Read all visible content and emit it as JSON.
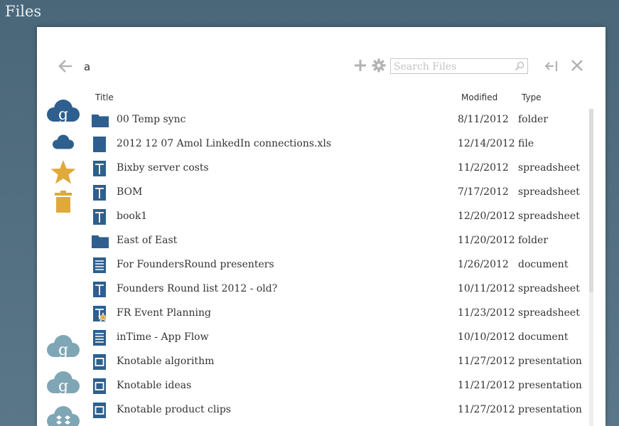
{
  "app": {
    "title": "Files"
  },
  "toolbar": {
    "path": "a",
    "search_placeholder": "Search Files",
    "icons": [
      "arrow-left-icon",
      "plus-icon",
      "gear-icon",
      "search-icon",
      "collapse-panel-icon",
      "close-icon"
    ]
  },
  "sources": [
    {
      "name": "google-drive",
      "icon": "google-cloud-icon"
    },
    {
      "name": "cloud",
      "icon": "cloud-icon"
    },
    {
      "name": "starred",
      "icon": "star-icon"
    },
    {
      "name": "trash",
      "icon": "trash-icon"
    },
    {
      "name": "google-drive-2",
      "icon": "google-cloud-icon"
    },
    {
      "name": "google-drive-3",
      "icon": "google-cloud-icon"
    },
    {
      "name": "dropbox",
      "icon": "dropbox-cloud-icon"
    }
  ],
  "columns": {
    "title": "Title",
    "modified": "Modified",
    "type": "Type"
  },
  "files": [
    {
      "title": "00 Temp sync",
      "modified": "8/11/2012",
      "type": "folder",
      "icon": "folder-icon"
    },
    {
      "title": "2012 12 07 Amol LinkedIn connections.xls",
      "modified": "12/14/2012",
      "type": "file",
      "icon": "file-icon"
    },
    {
      "title": "Bixby server costs",
      "modified": "11/2/2012",
      "type": "spreadsheet",
      "icon": "spreadsheet-icon"
    },
    {
      "title": "BOM",
      "modified": "7/17/2012",
      "type": "spreadsheet",
      "icon": "spreadsheet-icon"
    },
    {
      "title": "book1",
      "modified": "12/20/2012",
      "type": "spreadsheet",
      "icon": "spreadsheet-icon"
    },
    {
      "title": "East of East",
      "modified": "11/20/2012",
      "type": "folder",
      "icon": "folder-icon"
    },
    {
      "title": "For FoundersRound presenters",
      "modified": "1/26/2012",
      "type": "document",
      "icon": "document-icon"
    },
    {
      "title": "Founders Round list 2012 - old?",
      "modified": "10/11/2012",
      "type": "spreadsheet",
      "icon": "spreadsheet-icon"
    },
    {
      "title": "FR Event Planning",
      "modified": "11/23/2012",
      "type": "spreadsheet",
      "icon": "spreadsheet-starred-icon"
    },
    {
      "title": "inTime - App Flow",
      "modified": "10/10/2012",
      "type": "document",
      "icon": "document-icon"
    },
    {
      "title": "Knotable algorithm",
      "modified": "11/27/2012",
      "type": "presentation",
      "icon": "presentation-icon"
    },
    {
      "title": "Knotable ideas",
      "modified": "11/21/2012",
      "type": "presentation",
      "icon": "presentation-icon"
    },
    {
      "title": "Knotable product clips",
      "modified": "11/27/2012",
      "type": "presentation",
      "icon": "presentation-icon"
    }
  ],
  "colors": {
    "background": "#4e6b7d",
    "accent_blue": "#2e5f8e",
    "source_gold": "#e0a93a",
    "source_cloud_muted": "#7fa6b5"
  }
}
